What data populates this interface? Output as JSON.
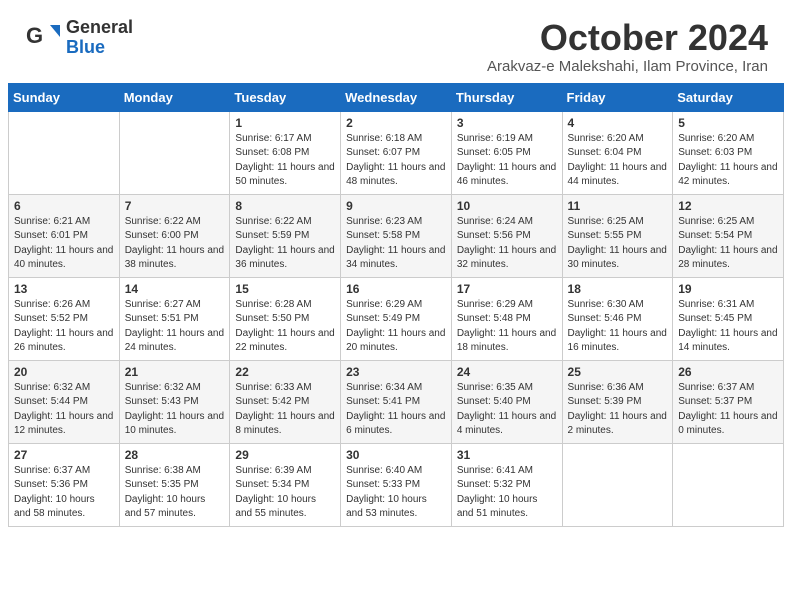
{
  "logo": {
    "general": "General",
    "blue": "Blue"
  },
  "title": "October 2024",
  "location": "Arakvaz-e Malekshahi, Ilam Province, Iran",
  "days": [
    "Sunday",
    "Monday",
    "Tuesday",
    "Wednesday",
    "Thursday",
    "Friday",
    "Saturday"
  ],
  "weeks": [
    [
      {
        "day": "",
        "content": ""
      },
      {
        "day": "",
        "content": ""
      },
      {
        "day": "1",
        "content": "Sunrise: 6:17 AM\nSunset: 6:08 PM\nDaylight: 11 hours and 50 minutes."
      },
      {
        "day": "2",
        "content": "Sunrise: 6:18 AM\nSunset: 6:07 PM\nDaylight: 11 hours and 48 minutes."
      },
      {
        "day": "3",
        "content": "Sunrise: 6:19 AM\nSunset: 6:05 PM\nDaylight: 11 hours and 46 minutes."
      },
      {
        "day": "4",
        "content": "Sunrise: 6:20 AM\nSunset: 6:04 PM\nDaylight: 11 hours and 44 minutes."
      },
      {
        "day": "5",
        "content": "Sunrise: 6:20 AM\nSunset: 6:03 PM\nDaylight: 11 hours and 42 minutes."
      }
    ],
    [
      {
        "day": "6",
        "content": "Sunrise: 6:21 AM\nSunset: 6:01 PM\nDaylight: 11 hours and 40 minutes."
      },
      {
        "day": "7",
        "content": "Sunrise: 6:22 AM\nSunset: 6:00 PM\nDaylight: 11 hours and 38 minutes."
      },
      {
        "day": "8",
        "content": "Sunrise: 6:22 AM\nSunset: 5:59 PM\nDaylight: 11 hours and 36 minutes."
      },
      {
        "day": "9",
        "content": "Sunrise: 6:23 AM\nSunset: 5:58 PM\nDaylight: 11 hours and 34 minutes."
      },
      {
        "day": "10",
        "content": "Sunrise: 6:24 AM\nSunset: 5:56 PM\nDaylight: 11 hours and 32 minutes."
      },
      {
        "day": "11",
        "content": "Sunrise: 6:25 AM\nSunset: 5:55 PM\nDaylight: 11 hours and 30 minutes."
      },
      {
        "day": "12",
        "content": "Sunrise: 6:25 AM\nSunset: 5:54 PM\nDaylight: 11 hours and 28 minutes."
      }
    ],
    [
      {
        "day": "13",
        "content": "Sunrise: 6:26 AM\nSunset: 5:52 PM\nDaylight: 11 hours and 26 minutes."
      },
      {
        "day": "14",
        "content": "Sunrise: 6:27 AM\nSunset: 5:51 PM\nDaylight: 11 hours and 24 minutes."
      },
      {
        "day": "15",
        "content": "Sunrise: 6:28 AM\nSunset: 5:50 PM\nDaylight: 11 hours and 22 minutes."
      },
      {
        "day": "16",
        "content": "Sunrise: 6:29 AM\nSunset: 5:49 PM\nDaylight: 11 hours and 20 minutes."
      },
      {
        "day": "17",
        "content": "Sunrise: 6:29 AM\nSunset: 5:48 PM\nDaylight: 11 hours and 18 minutes."
      },
      {
        "day": "18",
        "content": "Sunrise: 6:30 AM\nSunset: 5:46 PM\nDaylight: 11 hours and 16 minutes."
      },
      {
        "day": "19",
        "content": "Sunrise: 6:31 AM\nSunset: 5:45 PM\nDaylight: 11 hours and 14 minutes."
      }
    ],
    [
      {
        "day": "20",
        "content": "Sunrise: 6:32 AM\nSunset: 5:44 PM\nDaylight: 11 hours and 12 minutes."
      },
      {
        "day": "21",
        "content": "Sunrise: 6:32 AM\nSunset: 5:43 PM\nDaylight: 11 hours and 10 minutes."
      },
      {
        "day": "22",
        "content": "Sunrise: 6:33 AM\nSunset: 5:42 PM\nDaylight: 11 hours and 8 minutes."
      },
      {
        "day": "23",
        "content": "Sunrise: 6:34 AM\nSunset: 5:41 PM\nDaylight: 11 hours and 6 minutes."
      },
      {
        "day": "24",
        "content": "Sunrise: 6:35 AM\nSunset: 5:40 PM\nDaylight: 11 hours and 4 minutes."
      },
      {
        "day": "25",
        "content": "Sunrise: 6:36 AM\nSunset: 5:39 PM\nDaylight: 11 hours and 2 minutes."
      },
      {
        "day": "26",
        "content": "Sunrise: 6:37 AM\nSunset: 5:37 PM\nDaylight: 11 hours and 0 minutes."
      }
    ],
    [
      {
        "day": "27",
        "content": "Sunrise: 6:37 AM\nSunset: 5:36 PM\nDaylight: 10 hours and 58 minutes."
      },
      {
        "day": "28",
        "content": "Sunrise: 6:38 AM\nSunset: 5:35 PM\nDaylight: 10 hours and 57 minutes."
      },
      {
        "day": "29",
        "content": "Sunrise: 6:39 AM\nSunset: 5:34 PM\nDaylight: 10 hours and 55 minutes."
      },
      {
        "day": "30",
        "content": "Sunrise: 6:40 AM\nSunset: 5:33 PM\nDaylight: 10 hours and 53 minutes."
      },
      {
        "day": "31",
        "content": "Sunrise: 6:41 AM\nSunset: 5:32 PM\nDaylight: 10 hours and 51 minutes."
      },
      {
        "day": "",
        "content": ""
      },
      {
        "day": "",
        "content": ""
      }
    ]
  ]
}
